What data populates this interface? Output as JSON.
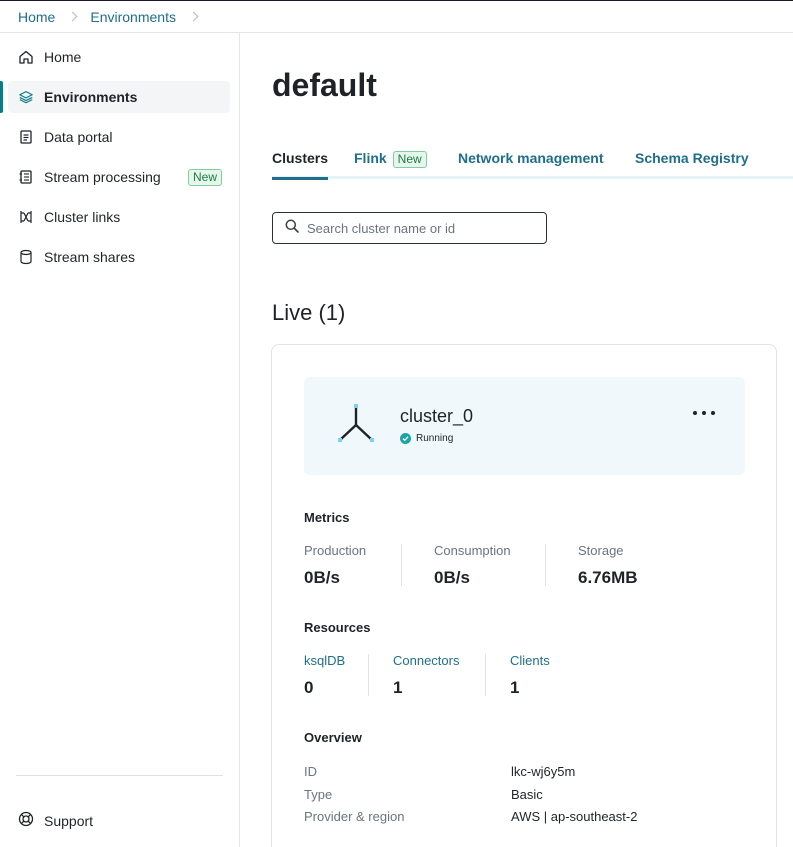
{
  "breadcrumb": {
    "items": [
      "Home",
      "Environments"
    ]
  },
  "sidebar": {
    "items": [
      {
        "label": "Home",
        "icon": "home-icon"
      },
      {
        "label": "Environments",
        "icon": "layers-icon",
        "active": true
      },
      {
        "label": "Data portal",
        "icon": "document-icon"
      },
      {
        "label": "Stream processing",
        "icon": "notebook-icon",
        "badge": "New"
      },
      {
        "label": "Cluster links",
        "icon": "link-icon"
      },
      {
        "label": "Stream shares",
        "icon": "database-icon"
      }
    ],
    "support_label": "Support"
  },
  "page": {
    "title": "default"
  },
  "tabs": [
    {
      "label": "Clusters",
      "active": true
    },
    {
      "label": "Flink",
      "badge": "New"
    },
    {
      "label": "Network management"
    },
    {
      "label": "Schema Registry"
    }
  ],
  "search": {
    "placeholder": "Search cluster name or id",
    "value": ""
  },
  "live": {
    "title": "Live (1)",
    "cluster": {
      "name": "cluster_0",
      "status": "Running",
      "metrics_title": "Metrics",
      "metrics": [
        {
          "label": "Production",
          "value": "0B/s"
        },
        {
          "label": "Consumption",
          "value": "0B/s"
        },
        {
          "label": "Storage",
          "value": "6.76MB"
        }
      ],
      "resources_title": "Resources",
      "resources": [
        {
          "label": "ksqlDB",
          "value": "0"
        },
        {
          "label": "Connectors",
          "value": "1"
        },
        {
          "label": "Clients",
          "value": "1"
        }
      ],
      "overview_title": "Overview",
      "overview": [
        {
          "key": "ID",
          "value": "lkc-wj6y5m"
        },
        {
          "key": "Type",
          "value": "Basic"
        },
        {
          "key": "Provider & region",
          "value": "AWS | ap-southeast-2"
        }
      ]
    }
  },
  "colors": {
    "accent": "#1f6f8b",
    "active_bar": "#0e7c86",
    "status_running": "#1aa5a5",
    "new_badge": "#1e7b43"
  }
}
